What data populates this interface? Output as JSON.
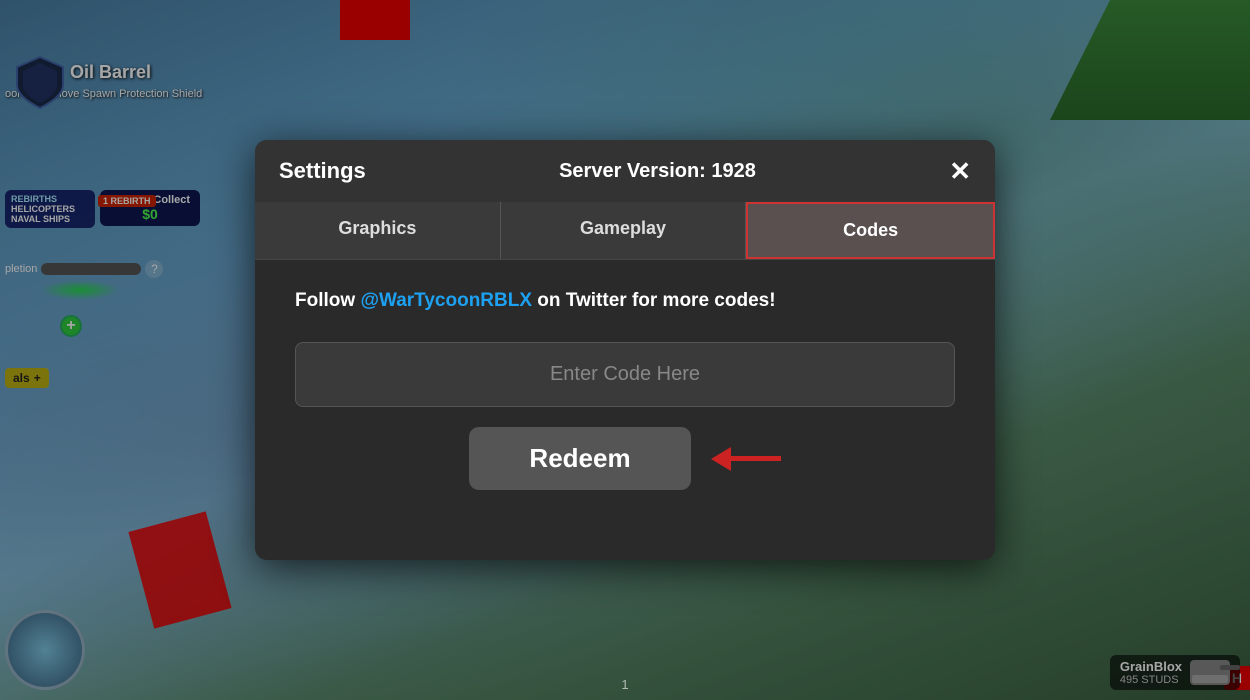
{
  "game": {
    "oil_barrel_label": "Oil Barrel",
    "spawn_protection_text": "oor To Remove Spawn Protection Shield",
    "rebirths_label": "REBIRTHS",
    "cash_to_collect_label": "Cash to Collect",
    "cash_amount": "$0",
    "completion_label": "pletion",
    "goals_label": "als",
    "player_name": "GrainBlox",
    "player_studs": "495 STUDS",
    "h_badge": "H",
    "page_number": "1",
    "server_version_number": "1928"
  },
  "modal": {
    "title": "Settings",
    "server_version_label": "Server Version: 1928",
    "close_label": "✕",
    "tabs": [
      {
        "id": "graphics",
        "label": "Graphics",
        "active": false
      },
      {
        "id": "gameplay",
        "label": "Gameplay",
        "active": false
      },
      {
        "id": "codes",
        "label": "Codes",
        "active": true
      }
    ],
    "codes_tab": {
      "twitter_text_before": "Follow ",
      "twitter_handle": "@WarTycoonRBLX",
      "twitter_text_after": " on Twitter for more codes!",
      "code_input_placeholder": "Enter Code Here",
      "redeem_button_label": "Redeem"
    }
  }
}
